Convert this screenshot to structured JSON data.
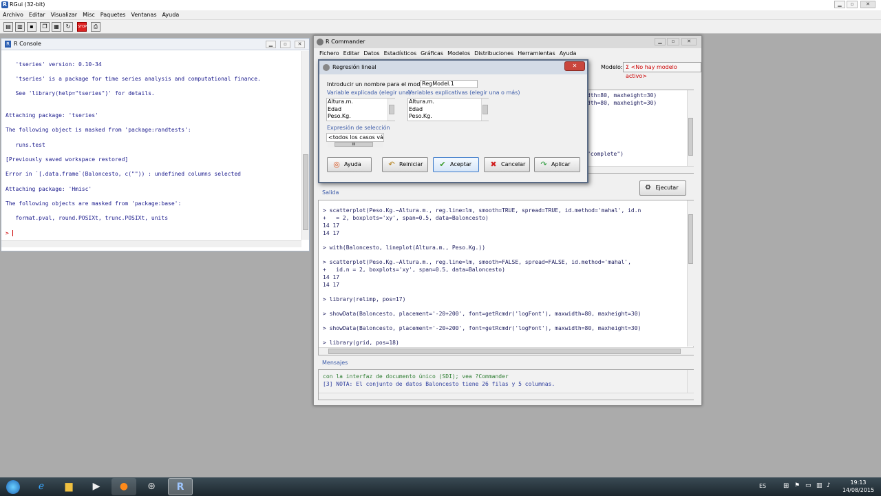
{
  "app": {
    "title": "RGui (32-bit)"
  },
  "menubar": [
    "Archivo",
    "Editar",
    "Visualizar",
    "Misc",
    "Paquetes",
    "Ventanas",
    "Ayuda"
  ],
  "console": {
    "title": "R Console",
    "lines": [
      "   'tseries' version: 0.10-34",
      "   'tseries' is a package for time series analysis and computational finance.",
      "   See 'library(help=\"tseries\")' for details.",
      "Attaching package: 'tseries'",
      "The following object is masked from 'package:randtests':",
      "   runs.test",
      "[Previously saved workspace restored]",
      "Error in `[.data.frame`(Baloncesto, c(\"\")) : undefined columns selected",
      "Attaching package: 'Hmisc'",
      "The following objects are masked from 'package:base':",
      "   format.pval, round.POSIXt, trunc.POSIXt, units",
      "> "
    ]
  },
  "rcmdr": {
    "title": "R Commander",
    "menu": [
      "Fichero",
      "Editar",
      "Datos",
      "Estadísticos",
      "Gráficas",
      "Modelos",
      "Distribuciones",
      "Herramientas",
      "Ayuda"
    ],
    "modelo_label": "Modelo:",
    "modelo_value": "Σ <No hay modelo activo>",
    "script_lines": [
      "dth=80, maxheight=30)",
      "dth=80, maxheight=30)",
      "\"complete\")"
    ],
    "ejecutar": "Ejecutar",
    "salida_label": "Salida",
    "output_lines": [
      "> scatterplot(Peso.Kg.~Altura.m., reg.line=lm, smooth=TRUE, spread=TRUE, id.method='mahal', id.n",
      "+   = 2, boxplots='xy', span=0.5, data=Baloncesto)",
      "14 17",
      "14 17",
      "> with(Baloncesto, lineplot(Altura.m., Peso.Kg.))",
      "> scatterplot(Peso.Kg.~Altura.m., reg.line=lm, smooth=FALSE, spread=FALSE, id.method='mahal',",
      "+   id.n = 2, boxplots='xy', span=0.5, data=Baloncesto)",
      "14 17",
      "14 17",
      "> library(relimp, pos=17)",
      "> showData(Baloncesto, placement='-20+200', font=getRcmdr('logFont'), maxwidth=80, maxheight=30)",
      "> showData(Baloncesto, placement='-20+200', font=getRcmdr('logFont'), maxwidth=80, maxheight=30)",
      "> library(grid, pos=18)"
    ],
    "mensajes_label": "Mensajes",
    "message_lines": [
      "con la interfaz de documento único (SDI); vea ?Commander",
      "[3] NOTA: El conjunto de datos Baloncesto tiene 26 filas y 5 columnas."
    ]
  },
  "dialog": {
    "title": "Regresión lineal",
    "name_label": "Introducir un nombre para el modelo:",
    "name_value": "RegModel.1",
    "explicada_label": "Variable explicada (elegir una)",
    "explicativas_label": "Variables explicativas (elegir una o más)",
    "vars": [
      "Altura.m.",
      "Edad",
      "Peso.Kg."
    ],
    "seleccion_label": "Expresión de selección",
    "seleccion_value": "<todos los casos válid",
    "scroll_glyph": "III",
    "buttons": {
      "ayuda": "Ayuda",
      "reiniciar": "Reiniciar",
      "aceptar": "Aceptar",
      "cancelar": "Cancelar",
      "aplicar": "Aplicar"
    }
  },
  "taskbar": {
    "lang": "ES",
    "time": "19:13",
    "date": "14/08/2015"
  },
  "colors": {
    "console_text": "#1a1a8c",
    "link_blue": "#3a5aa8",
    "message_green": "#2e7d32"
  }
}
